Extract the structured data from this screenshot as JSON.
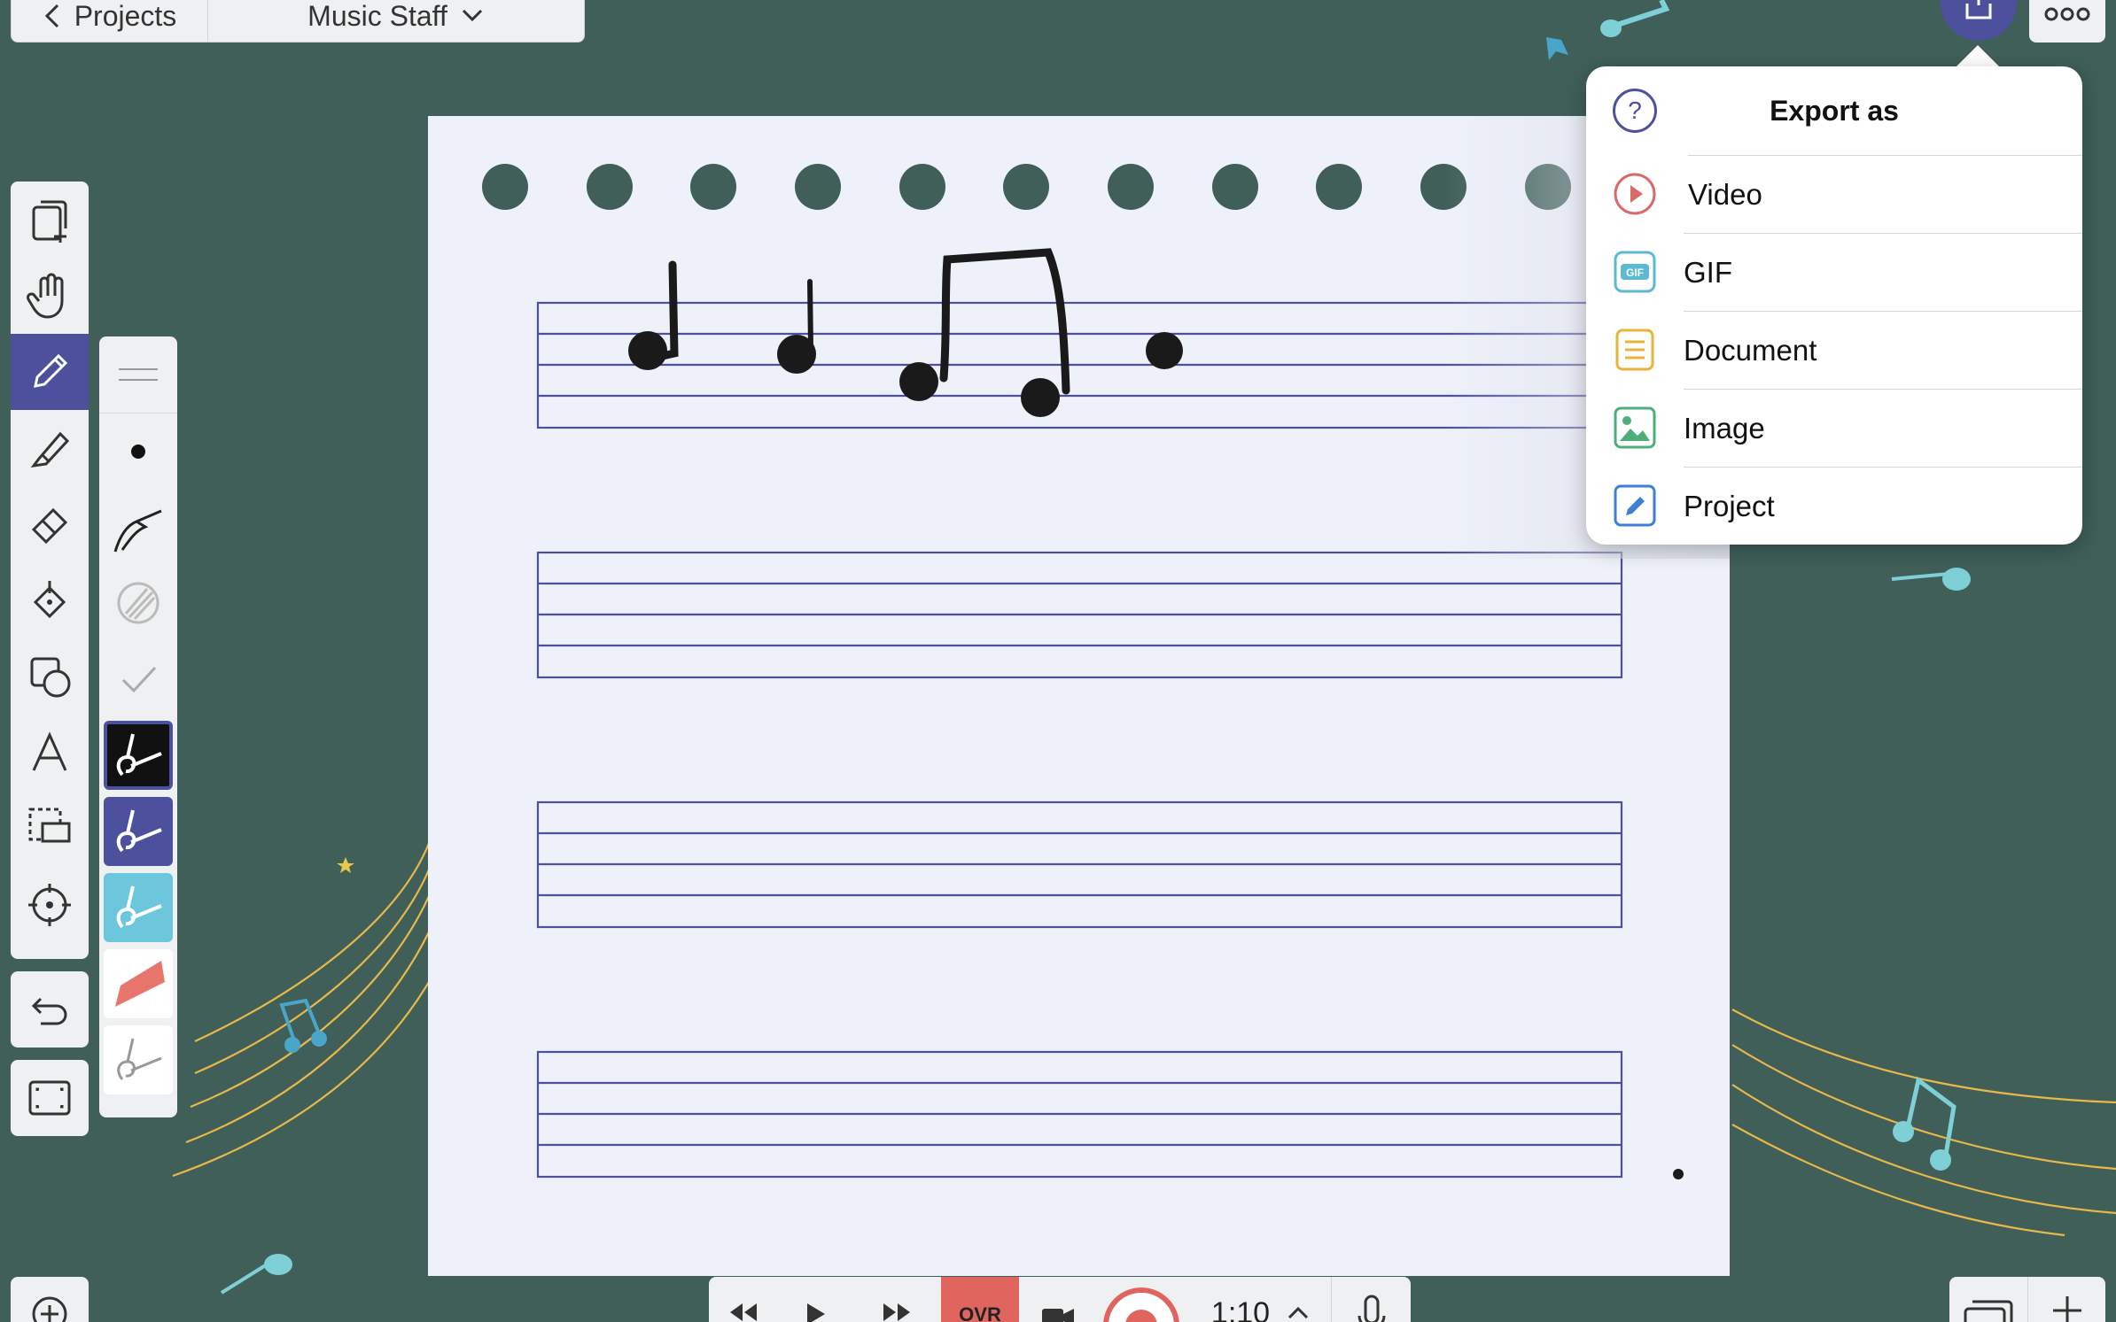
{
  "nav": {
    "back_label": "Projects",
    "project_title": "Music Staff"
  },
  "export_menu": {
    "title": "Export as",
    "help_glyph": "?",
    "items": [
      {
        "label": "Video",
        "icon": "video-play-icon",
        "color": "#d96a6a"
      },
      {
        "label": "GIF",
        "icon": "gif-icon",
        "color": "#5bb9d3",
        "badge": "GIF"
      },
      {
        "label": "Document",
        "icon": "document-icon",
        "color": "#e8b43a"
      },
      {
        "label": "Image",
        "icon": "image-icon",
        "color": "#4caf7a"
      },
      {
        "label": "Project",
        "icon": "pencil-project-icon",
        "color": "#3f7fd6"
      }
    ]
  },
  "playback": {
    "ovr_label": "OVR",
    "time": "1:10"
  },
  "colors": {
    "background": "#3f5f58",
    "accent": "#4c509d",
    "canvas": "#eef1fa",
    "staff_line": "#4c509d",
    "record": "#e0655e"
  },
  "tools": [
    "add-page-icon",
    "hand-icon",
    "pencil-icon",
    "highlighter-icon",
    "eraser-icon",
    "fill-icon",
    "shapes-icon",
    "text-icon",
    "select-icon",
    "target-icon",
    "undo-icon",
    "frame-icon"
  ],
  "brushes": [
    "line-weight-icon",
    "dot-brush-icon",
    "pen-brush-icon",
    "texture-icon",
    "check-icon",
    "black-pen-swatch",
    "indigo-pen-swatch",
    "cyan-pen-swatch",
    "red-marker-swatch",
    "white-pen-swatch"
  ]
}
